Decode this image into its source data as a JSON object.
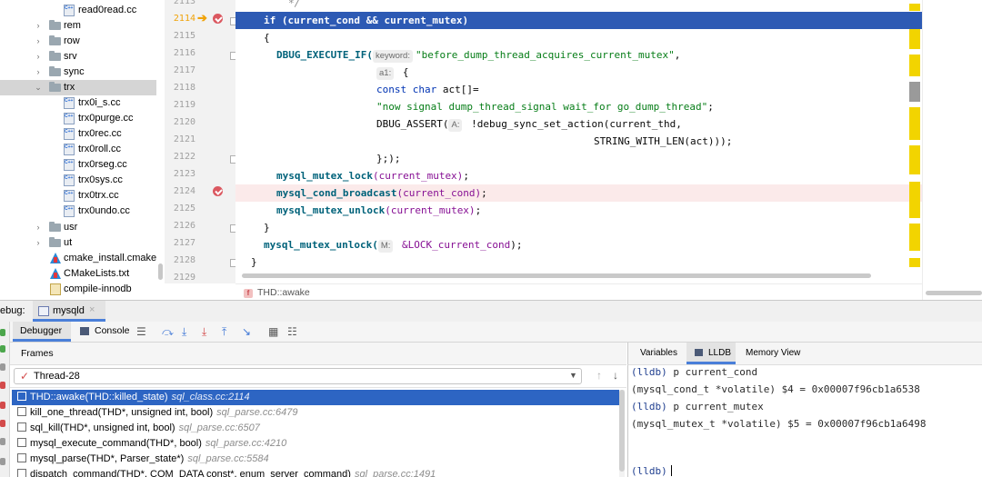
{
  "tree": {
    "items": [
      {
        "label": "read0read.cc",
        "type": "cfile",
        "level": 3
      },
      {
        "label": "rem",
        "type": "folder",
        "level": 2
      },
      {
        "label": "row",
        "type": "folder",
        "level": 2
      },
      {
        "label": "srv",
        "type": "folder",
        "level": 2
      },
      {
        "label": "sync",
        "type": "folder",
        "level": 2
      },
      {
        "label": "trx",
        "type": "folder-open",
        "level": 2
      },
      {
        "label": "trx0i_s.cc",
        "type": "cfile",
        "level": 3
      },
      {
        "label": "trx0purge.cc",
        "type": "cfile",
        "level": 3
      },
      {
        "label": "trx0rec.cc",
        "type": "cfile",
        "level": 3
      },
      {
        "label": "trx0roll.cc",
        "type": "cfile",
        "level": 3
      },
      {
        "label": "trx0rseg.cc",
        "type": "cfile",
        "level": 3
      },
      {
        "label": "trx0sys.cc",
        "type": "cfile",
        "level": 3
      },
      {
        "label": "trx0trx.cc",
        "type": "cfile",
        "level": 3
      },
      {
        "label": "trx0undo.cc",
        "type": "cfile",
        "level": 3
      },
      {
        "label": "usr",
        "type": "folder",
        "level": 2
      },
      {
        "label": "ut",
        "type": "folder",
        "level": 2
      },
      {
        "label": "cmake_install.cmake",
        "type": "cmake",
        "level": 2
      },
      {
        "label": "CMakeLists.txt",
        "type": "cmake",
        "level": 2
      },
      {
        "label": "compile-innodb",
        "type": "generic",
        "level": 2
      }
    ]
  },
  "editor": {
    "line_numbers": [
      "2113",
      "2114",
      "2115",
      "2116",
      "2117",
      "2118",
      "2119",
      "2120",
      "2121",
      "2122",
      "2123",
      "2124",
      "2125",
      "2126",
      "2127",
      "2128",
      "2129"
    ],
    "code": {
      "l2113": "*/",
      "l2114_kw": "if",
      "l2114_rest": " (current_cond && current_mutex)",
      "l2115": "{",
      "l2116_fn": "DBUG_EXECUTE_IF(",
      "l2116_hint": "keyword:",
      "l2116_str": "\"before_dump_thread_acquires_current_mutex\"",
      "l2116_end": ",",
      "l2117_hint": "a1:",
      "l2117_rest": " {",
      "l2118_kw": "const char",
      "l2118_rest": " act[]=",
      "l2119_str": "\"now signal dump_thread_signal wait_for go_dump_thread\"",
      "l2119_end": ";",
      "l2120_fn": "DBUG_ASSERT(",
      "l2120_hint": "A:",
      "l2120_rest": " !debug_sync_set_action(current_thd,",
      "l2121": "STRING_WITH_LEN(act)));",
      "l2122": "};);",
      "l2123_fn": "mysql_mutex_lock",
      "l2123_var": "(current_mutex)",
      "l2123_end": ";",
      "l2124_fn": "mysql_cond_broadcast",
      "l2124_var": "(current_cond)",
      "l2124_end": ";",
      "l2125_fn": "mysql_mutex_unlock",
      "l2125_var": "(current_mutex)",
      "l2125_end": ";",
      "l2126": "}",
      "l2127_fn": "mysql_mutex_unlock(",
      "l2127_hint": "M:",
      "l2127_var": " &LOCK_current_cond",
      "l2127_end": ");",
      "l2128": "}"
    },
    "breadcrumb": "THD::awake",
    "breadcrumb_badge": "f"
  },
  "debug": {
    "label": "ebug:",
    "tab": "mysqld",
    "tab_close": "×",
    "toolbar": {
      "debugger_tab": "Debugger",
      "console_tab": "Console"
    },
    "frames_header": "Frames",
    "thread": "Thread-28",
    "frames": [
      {
        "fn": "THD::awake(THD::killed_state)",
        "loc": "sql_class.cc:2114"
      },
      {
        "fn": "kill_one_thread(THD*, unsigned int, bool)",
        "loc": "sql_parse.cc:6479"
      },
      {
        "fn": "sql_kill(THD*, unsigned int, bool)",
        "loc": "sql_parse.cc:6507"
      },
      {
        "fn": "mysql_execute_command(THD*, bool)",
        "loc": "sql_parse.cc:4210"
      },
      {
        "fn": "mysql_parse(THD*, Parser_state*)",
        "loc": "sql_parse.cc:5584"
      },
      {
        "fn": "dispatch_command(THD*, COM_DATA const*, enum_server_command)",
        "loc": "sql_parse.cc:1491"
      }
    ],
    "right_tabs": {
      "variables": "Variables",
      "lldb": "LLDB",
      "memory": "Memory View"
    },
    "lldb": {
      "l1_prompt": "(lldb)",
      "l1_cmd": " p current_cond",
      "l2": "(mysql_cond_t *volatile) $4 = 0x00007f96cb1a6538",
      "l3_prompt": "(lldb)",
      "l3_cmd": " p current_mutex",
      "l4": "(mysql_mutex_t *volatile) $5 = 0x00007f96cb1a6498",
      "l5_prompt": "(lldb)"
    }
  }
}
